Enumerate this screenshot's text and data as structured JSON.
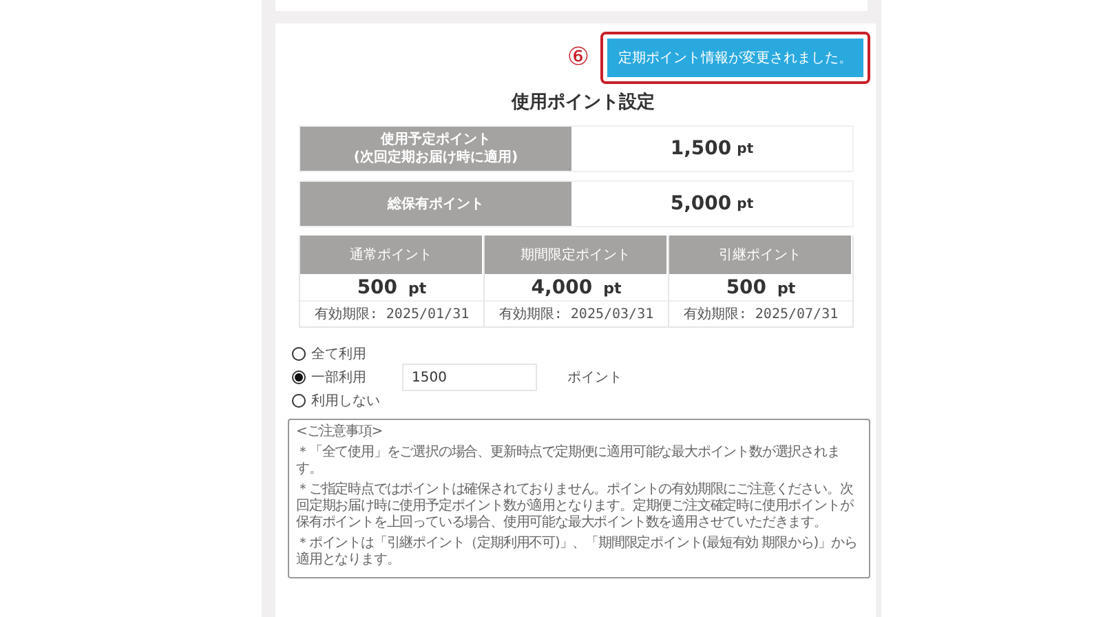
{
  "annotation": {
    "marker": "⑥",
    "message": "定期ポイント情報が変更されました。"
  },
  "title": "使用ポイント設定",
  "summary": [
    {
      "label": "使用予定ポイント\n(次回定期お届け時に適用)",
      "amount": "1,500",
      "unit": "pt"
    },
    {
      "label": "総保有ポイント",
      "amount": "5,000",
      "unit": "pt"
    }
  ],
  "breakdown": [
    {
      "label": "通常ポイント",
      "amount": "500",
      "unit": "pt",
      "expiry": "有効期限: 2025/01/31"
    },
    {
      "label": "期間限定ポイント",
      "amount": "4,000",
      "unit": "pt",
      "expiry": "有効期限: 2025/03/31"
    },
    {
      "label": "引継ポイント",
      "amount": "500",
      "unit": "pt",
      "expiry": "有効期限: 2025/07/31"
    }
  ],
  "usage_options": [
    {
      "label": "全て利用",
      "selected": false
    },
    {
      "label": "一部利用",
      "selected": true
    },
    {
      "label": "利用しない",
      "selected": false
    }
  ],
  "points_field": {
    "value": "1500",
    "unit": "ポイント"
  },
  "notes": {
    "heading": "<ご注意事項>",
    "items": [
      "＊「全て使用」をご選択の場合、更新時点で定期便に適用可能な最大ポイント数が選択されます。",
      "＊ご指定時点ではポイントは確保されておりません。ポイントの有効期限にご注意ください。次回定期お届け時に使用予定ポイント数が適用となります。定期便ご注文確定時に使用ポイントが保有ポイントを上回っている場合、使用可能な最大ポイント数を適用させていただきます。",
      "＊ポイントは「引継ポイント（定期利用不可)」、「期間限定ポイント(最短有効 期限から)」から適用となります。"
    ]
  }
}
